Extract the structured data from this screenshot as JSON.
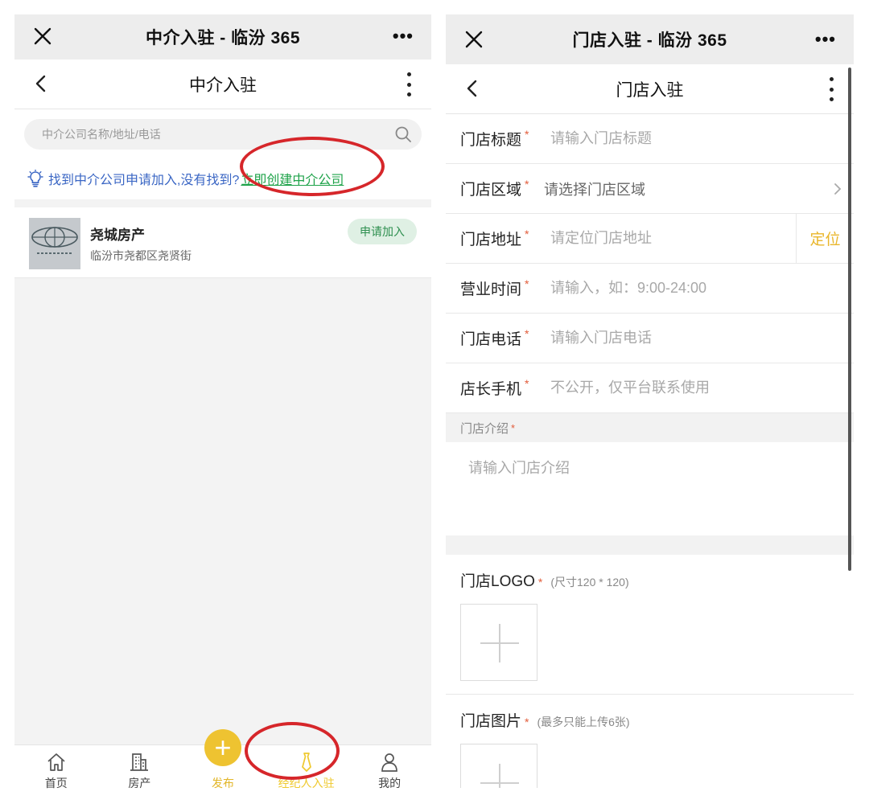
{
  "left": {
    "wx_title": "中介入驻 - 临汾 365",
    "page_title": "中介入驻",
    "search_placeholder": "中介公司名称/地址/电话",
    "tip_text": "找到中介公司申请加入,没有找到?",
    "create_link": "立即创建中介公司",
    "agencies": [
      {
        "name": "尧城房产",
        "address": "临汾市尧都区尧贤街",
        "action": "申请加入"
      }
    ],
    "tabs": [
      {
        "label": "首页",
        "icon": "home-icon"
      },
      {
        "label": "房产",
        "icon": "building-icon"
      },
      {
        "label": "发布",
        "icon": "plus-icon"
      },
      {
        "label": "经纪人入驻",
        "icon": "tie-icon"
      },
      {
        "label": "我的",
        "icon": "person-icon"
      }
    ]
  },
  "right": {
    "wx_title": "门店入驻 - 临汾 365",
    "page_title": "门店入驻",
    "required_mark": "*",
    "fields": [
      {
        "label": "门店标题",
        "placeholder": "请输入门店标题"
      },
      {
        "label": "门店区域",
        "placeholder": "请选择门店区域"
      },
      {
        "label": "门店地址",
        "placeholder": "请定位门店地址",
        "button": "定位"
      },
      {
        "label": "营业时间",
        "placeholder": "请输入，如：9:00-24:00"
      },
      {
        "label": "门店电话",
        "placeholder": "请输入门店电话"
      },
      {
        "label": "店长手机",
        "placeholder": "不公开，仅平台联系使用"
      }
    ],
    "intro": {
      "label": "门店介绍",
      "placeholder": "请输入门店介绍"
    },
    "logo": {
      "label": "门店LOGO",
      "hint": "(尺寸120 * 120)"
    },
    "photos": {
      "label": "门店图片",
      "hint": "(最多只能上传6张)"
    }
  },
  "colors": {
    "accent_yellow": "#eec331",
    "link_green": "#1fa34a",
    "tip_blue": "#3a66c4",
    "annotation_red": "#d6262a"
  }
}
